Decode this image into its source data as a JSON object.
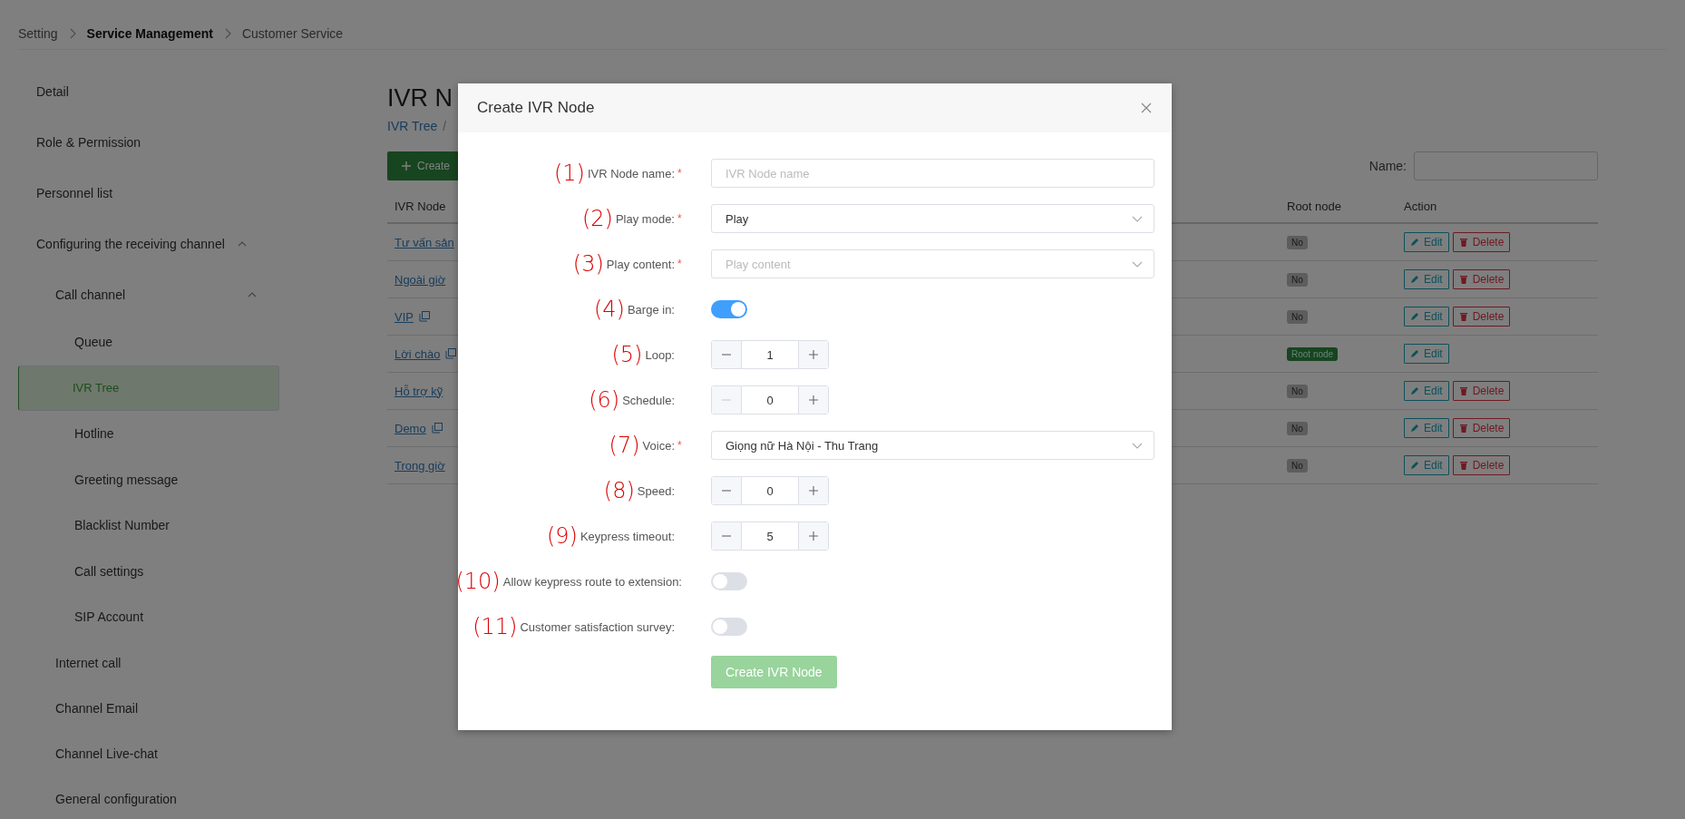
{
  "breadcrumb": [
    {
      "label": "Setting",
      "selected": false
    },
    {
      "label": "Service Management",
      "selected": true
    },
    {
      "label": "Customer Service",
      "selected": false
    }
  ],
  "sidebar": {
    "items": [
      {
        "label": "Detail",
        "selected": false
      },
      {
        "label": "Role & Permission",
        "selected": false
      },
      {
        "label": "Personnel list",
        "selected": false
      },
      {
        "label": "Configuring the receiving channel",
        "selected": false,
        "expanded": true,
        "children": [
          {
            "label": "Call channel",
            "selected": false,
            "expanded": true,
            "children": [
              {
                "label": "Queue",
                "selected": false
              },
              {
                "label": "IVR Tree",
                "selected": true
              },
              {
                "label": "Hotline",
                "selected": false
              },
              {
                "label": "Greeting message",
                "selected": false
              },
              {
                "label": "Blacklist Number",
                "selected": false
              },
              {
                "label": "Call settings",
                "selected": false
              },
              {
                "label": "SIP Account",
                "selected": false
              }
            ]
          },
          {
            "label": "Internet call",
            "selected": false
          },
          {
            "label": "Channel Email",
            "selected": false
          },
          {
            "label": "Channel Live-chat",
            "selected": false
          },
          {
            "label": "General configuration",
            "selected": false
          }
        ]
      }
    ]
  },
  "page": {
    "title": "IVR N",
    "path": [
      {
        "label": "IVR Tree"
      }
    ],
    "path_separator": "/",
    "create_button": {
      "label": "Create"
    },
    "filter": {
      "label": "Name:"
    }
  },
  "table": {
    "columns": [
      "IVR Node",
      "Root node",
      "Action"
    ],
    "rows": [
      {
        "name": "Tư vấn sản",
        "copyable": false,
        "root": {
          "label": "No",
          "is_root": false
        },
        "actions": [
          {
            "kind": "edit",
            "label": "Edit"
          },
          {
            "kind": "delete",
            "label": "Delete"
          }
        ]
      },
      {
        "name": "Ngoài giờ",
        "copyable": false,
        "root": {
          "label": "No",
          "is_root": false
        },
        "actions": [
          {
            "kind": "edit",
            "label": "Edit"
          },
          {
            "kind": "delete",
            "label": "Delete"
          }
        ]
      },
      {
        "name": "VIP",
        "copyable": true,
        "root": {
          "label": "No",
          "is_root": false
        },
        "actions": [
          {
            "kind": "edit",
            "label": "Edit"
          },
          {
            "kind": "delete",
            "label": "Delete"
          }
        ]
      },
      {
        "name": "Lời chào",
        "copyable": true,
        "root": {
          "label": "Root node",
          "is_root": true
        },
        "actions": [
          {
            "kind": "edit",
            "label": "Edit"
          }
        ]
      },
      {
        "name": "Hỗ trợ kỹ",
        "copyable": false,
        "root": {
          "label": "No",
          "is_root": false
        },
        "actions": [
          {
            "kind": "edit",
            "label": "Edit"
          },
          {
            "kind": "delete",
            "label": "Delete"
          }
        ]
      },
      {
        "name": "Demo",
        "copyable": true,
        "root": {
          "label": "No",
          "is_root": false
        },
        "actions": [
          {
            "kind": "edit",
            "label": "Edit"
          },
          {
            "kind": "delete",
            "label": "Delete"
          }
        ]
      },
      {
        "name": "Trong giờ",
        "copyable": false,
        "root": {
          "label": "No",
          "is_root": false
        },
        "actions": [
          {
            "kind": "edit",
            "label": "Edit"
          },
          {
            "kind": "delete",
            "label": "Delete"
          }
        ]
      }
    ]
  },
  "modal": {
    "title": "Create IVR Node",
    "required_mark": "*",
    "fields": [
      {
        "number": "(1)",
        "label": "IVR Node name:",
        "required": true,
        "kind": "text",
        "placeholder": "IVR Node name"
      },
      {
        "number": "(2)",
        "label": "Play mode:",
        "required": true,
        "kind": "select",
        "value": "Play"
      },
      {
        "number": "(3)",
        "label": "Play content:",
        "required": true,
        "kind": "select",
        "placeholder": "Play content"
      },
      {
        "number": "(4)",
        "label": "Barge in:",
        "required": false,
        "kind": "switch",
        "on": true
      },
      {
        "number": "(5)",
        "label": "Loop:",
        "required": false,
        "kind": "number",
        "value": "1",
        "minus_disabled": false
      },
      {
        "number": "(6)",
        "label": "Schedule:",
        "required": false,
        "kind": "number",
        "value": "0",
        "minus_disabled": true
      },
      {
        "number": "(7)",
        "label": "Voice:",
        "required": true,
        "kind": "select",
        "value": "Giọng nữ Hà Nội - Thu Trang"
      },
      {
        "number": "(8)",
        "label": "Speed:",
        "required": false,
        "kind": "number",
        "value": "0",
        "minus_disabled": false
      },
      {
        "number": "(9)",
        "label": "Keypress timeout:",
        "required": false,
        "kind": "number",
        "value": "5",
        "minus_disabled": false
      },
      {
        "number": "(10)",
        "label": "Allow keypress route to extension:",
        "required": false,
        "kind": "switch",
        "on": false
      },
      {
        "number": "(11)",
        "label": "Customer satisfaction survey:",
        "required": false,
        "kind": "switch",
        "on": false
      }
    ],
    "submit": {
      "label": "Create IVR Node",
      "disabled": true
    }
  }
}
